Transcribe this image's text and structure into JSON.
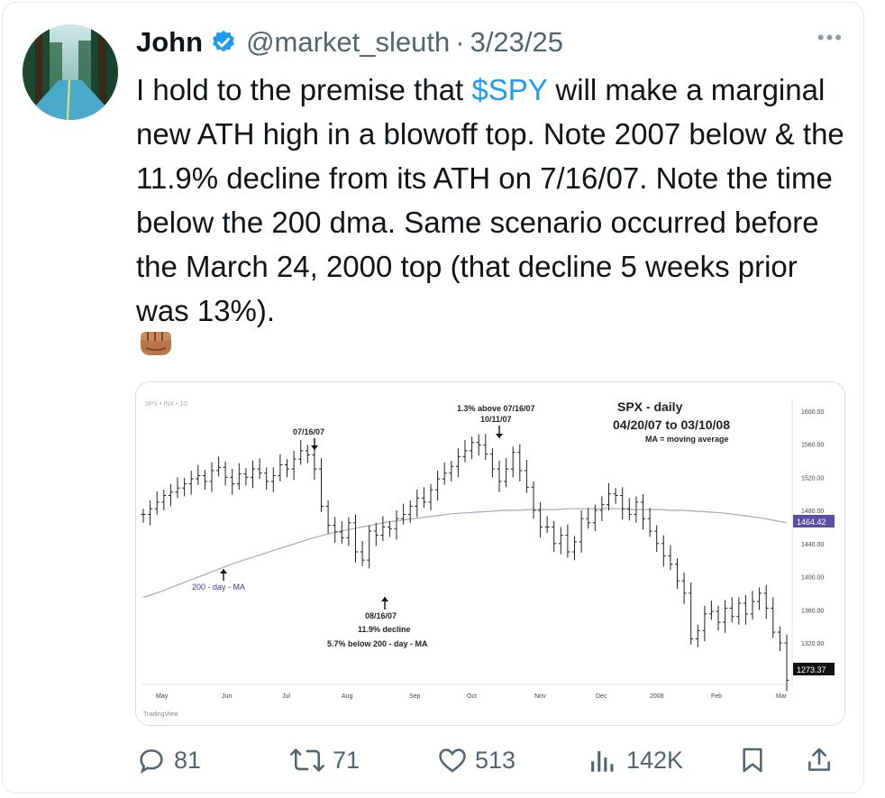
{
  "tweet": {
    "name": "John",
    "handle": "@market_sleuth",
    "separator": "·",
    "date": "3/23/25",
    "more_label": "•••",
    "text_before": "I hold to the premise that ",
    "cashtag": "$SPY",
    "text_after": " will make a marginal new ATH high in a blowoff top. Note 2007 below & the 11.9% decline from its ATH on 7/16/07. Note the time below the 200 dma. Same scenario occurred before the March 24, 2000 top (that decline 5 weeks prior was 13%).",
    "emoji_icon": "oncoming-fist-icon"
  },
  "chart_data": {
    "type": "line",
    "title": "SPX - daily",
    "subtitle": "04/20/07 to 03/10/08",
    "note": "MA = moving average",
    "watermark": "TradingView",
    "x_tick_labels": [
      "May",
      "Jun",
      "Jul",
      "Aug",
      "Sep",
      "Oct",
      "Nov",
      "Dec",
      "2008",
      "Feb",
      "Mar"
    ],
    "y_tick_labels": [
      "1600.00",
      "1560.00",
      "1520.00",
      "1480.00",
      "1440.00",
      "1400.00",
      "1360.00",
      "1320.00"
    ],
    "ylim": [
      1270,
      1615
    ],
    "price_label_ma": "1464.42",
    "price_label_last": "1273.37",
    "annotations": {
      "ath": "07/16/07",
      "high_line1": "1.3% above 07/16/07",
      "high_line2": "10/11/07",
      "low_line1": "08/16/07",
      "low_line2": "11.9% decline",
      "low_line3": "5.7% below 200 - day - MA",
      "ma_label": "200 - day - MA"
    },
    "series": [
      {
        "name": "200 - day - MA",
        "values": [
          1375,
          1380,
          1386,
          1392,
          1398,
          1404,
          1410,
          1416,
          1421,
          1426,
          1431,
          1436,
          1441,
          1446,
          1450,
          1454,
          1457,
          1460,
          1463,
          1466,
          1468,
          1470,
          1472,
          1474,
          1476,
          1477,
          1478,
          1479,
          1480,
          1480,
          1481,
          1481,
          1481,
          1482,
          1482,
          1482,
          1482,
          1482,
          1481,
          1481,
          1481,
          1480,
          1480,
          1479,
          1478,
          1477,
          1475,
          1473,
          1471,
          1468,
          1465
        ]
      },
      {
        "name": "",
        "values": [
          1475,
          1482,
          1490,
          1498,
          1502,
          1507,
          1512,
          1518,
          1522,
          1515,
          1528,
          1532,
          1520,
          1512,
          1524,
          1520,
          1530,
          1525,
          1515,
          1522,
          1535,
          1530,
          1542,
          1552,
          1547,
          1530,
          1485,
          1462,
          1454,
          1447,
          1465,
          1430,
          1420,
          1455,
          1450,
          1460,
          1458,
          1470,
          1475,
          1485,
          1495,
          1490,
          1505,
          1518,
          1525,
          1533,
          1545,
          1552,
          1562,
          1559,
          1548,
          1530,
          1515,
          1530,
          1550,
          1528,
          1508,
          1480,
          1460,
          1460,
          1440,
          1450,
          1430,
          1442,
          1470,
          1465,
          1480,
          1487,
          1500,
          1498,
          1482,
          1475,
          1490,
          1470,
          1455,
          1440,
          1425,
          1415,
          1395,
          1380,
          1325,
          1335,
          1355,
          1358,
          1345,
          1362,
          1352,
          1368,
          1355,
          1370,
          1380,
          1362,
          1333,
          1320,
          1275
        ]
      }
    ]
  }
}
